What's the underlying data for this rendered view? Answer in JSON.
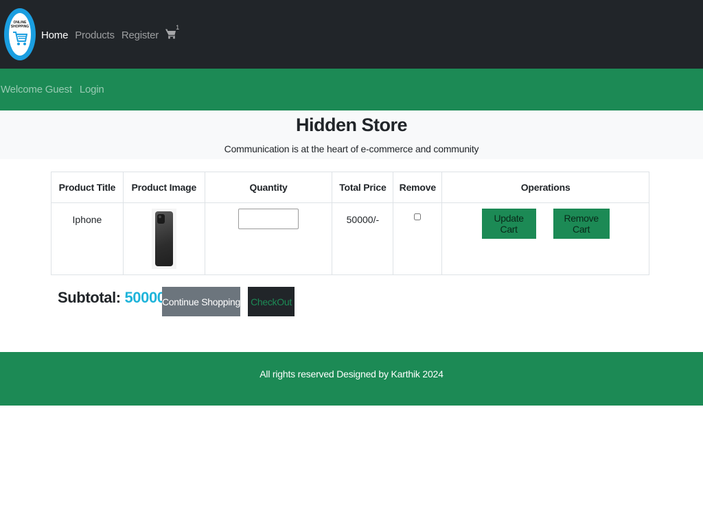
{
  "nav": {
    "logo_text": "ONLINE SHOPPING",
    "links": [
      "Home",
      "Products",
      "Register"
    ],
    "cart_count": "1",
    "cart_icon": "shopping-cart-icon"
  },
  "subnav": {
    "welcome": "Welcome Guest",
    "login": "Login"
  },
  "hero": {
    "title": "Hidden Store",
    "subtitle": "Communication is at the heart of e-commerce and community"
  },
  "table": {
    "headers": [
      "Product Title",
      "Product Image",
      "Quantity",
      "Total Price",
      "Remove",
      "Operations"
    ],
    "rows": [
      {
        "title": "Iphone",
        "image": "iphone-image",
        "quantity": "",
        "total_price": "50000/-",
        "remove_checked": false,
        "update_label": "Update Cart",
        "remove_label": "Remove Cart"
      }
    ]
  },
  "summary": {
    "subtotal_label": "Subtotal: ",
    "subtotal_value": "50000/-",
    "continue_label": "Continue Shopping",
    "checkout_label": "CheckOut"
  },
  "footer": {
    "text": "All rights reserved Designed by Karthik 2024"
  },
  "colors": {
    "dark": "#212529",
    "green": "#1c8a55",
    "accent": "#1fb4da",
    "grey": "#6c757d",
    "light": "#f8f9fa"
  }
}
